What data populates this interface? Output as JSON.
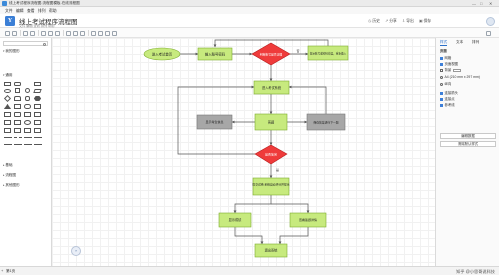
{
  "window": {
    "title": "线上考试程序流程图-流程图模板-在线流程图",
    "controls": [
      "—",
      "□",
      "✕"
    ]
  },
  "menu": [
    "文件",
    "编辑",
    "查看",
    "排列",
    "帮助"
  ],
  "document": {
    "logo_letter": "Y",
    "title": "线上考试程序流程图",
    "subtitle": "文件  编辑  查看  排列  帮助"
  },
  "header_buttons": [
    {
      "icon": "clock-icon",
      "label": "历史"
    },
    {
      "icon": "share-icon",
      "label": "分享"
    },
    {
      "icon": "export-icon",
      "label": "导出"
    },
    {
      "icon": "save-icon",
      "label": "保存"
    }
  ],
  "sidebar": {
    "search_placeholder": "",
    "sections": [
      "我的图形",
      "通用",
      "基础",
      "流程图",
      "其他图形"
    ]
  },
  "flowchart": {
    "nodes": {
      "start": "进入考试首页",
      "login": "输入账号密码",
      "check": "判断账号是否正确",
      "retry": "提示账号或密码错误，重新输入",
      "enter": "进入考试系统",
      "left_box": "显示考生信息",
      "middle_box": "答题",
      "right_box": "保存答案进行下一题",
      "finish_check": "是否答完",
      "submit": "提交试卷\n系统自动评分并提示",
      "score": "显示成绩",
      "review": "查看答题详情",
      "end": "退出系统"
    },
    "edge_labels": {
      "no": "否",
      "yes": "是"
    }
  },
  "right_panel": {
    "tabs": [
      "样式",
      "文本",
      "排列"
    ],
    "group_title": "页面",
    "rows": [
      {
        "type": "checkbox",
        "label": "网格",
        "on": true
      },
      {
        "type": "checkbox",
        "label": "页面视图",
        "on": true
      },
      {
        "type": "checkbox",
        "label": "背景",
        "on": false
      },
      {
        "type": "radio",
        "label": "A4 (210 mm x 297 mm)"
      },
      {
        "type": "radio",
        "label": "纵向"
      },
      {
        "type": "checkbox",
        "label": "连接箭头",
        "on": true
      },
      {
        "type": "checkbox",
        "label": "连接点",
        "on": true
      },
      {
        "type": "checkbox",
        "label": "参考线",
        "on": true
      }
    ],
    "buttons": [
      "编辑数据",
      "清除默认样式"
    ]
  },
  "status": {
    "page_tab": "第1页",
    "add_page": "+",
    "footer_mark": "知乎 @小思哥说科技"
  },
  "watermark": "仅测试",
  "help_label": "?",
  "colors": {
    "node_green": "#b7e07a",
    "node_green_border": "#7cab2e",
    "diamond_red": "#ef3b3b",
    "accent_blue": "#2a6fc9",
    "edge": "#555555"
  }
}
